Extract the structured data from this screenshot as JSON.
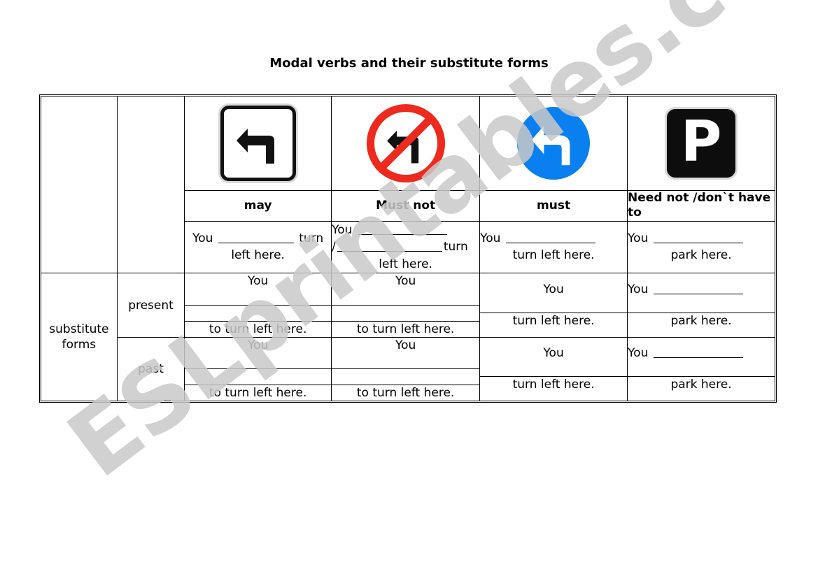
{
  "page": {
    "title": "Modal verbs and their substitute forms",
    "watermark": "ESLprintables.com"
  },
  "table": {
    "row_labels": {
      "substitute_forms": "substitute forms",
      "present": "present",
      "past": "past"
    },
    "columns": [
      {
        "sign": {
          "name": "left-turn-permitted-sign",
          "type": "white-square-arrow",
          "colors": {
            "background": "#ffffff",
            "border": "#111111",
            "arrow": "#111111"
          }
        },
        "modal": "may",
        "sentence": {
          "line1_prefix": "You",
          "line1_suffix": "turn",
          "line2": "left here."
        },
        "present": {
          "word": "You",
          "tail": "to turn left here.",
          "blank_lines": 2
        },
        "past": {
          "word": "You",
          "tail": "to turn left here.",
          "blank_lines": 2
        }
      },
      {
        "sign": {
          "name": "no-left-turn-sign",
          "type": "red-circle-slash-arrow",
          "colors": {
            "ring": "#ee2a1e",
            "background": "#ffffff",
            "arrow": "#111111"
          }
        },
        "modal": "Must not",
        "sentence": {
          "line1_prefix": "You",
          "line2_prefix": "/",
          "line2_suffix": "turn",
          "line3": "left here."
        },
        "present": {
          "word": "You",
          "tail": "to turn left here.",
          "blank_lines": 2
        },
        "past": {
          "word": "You",
          "tail": "to turn left here.",
          "blank_lines": 2
        }
      },
      {
        "sign": {
          "name": "turn-left-mandatory-sign",
          "type": "blue-circle-arrow",
          "colors": {
            "background": "#0a7ff0",
            "arrow": "#ffffff"
          }
        },
        "modal": "must",
        "sentence": {
          "line1_prefix": "You",
          "line2": "turn left here."
        },
        "present": {
          "word": "You",
          "tail": "turn left here.",
          "blank_lines": 1
        },
        "past": {
          "word": "You",
          "tail": "turn left here.",
          "blank_lines": 1
        }
      },
      {
        "sign": {
          "name": "parking-sign",
          "type": "black-square-p",
          "glyph": "P",
          "colors": {
            "background": "#0d0d0d",
            "glyph": "#ffffff"
          }
        },
        "modal": "Need not /don`t have to",
        "sentence": {
          "line1_prefix": "You",
          "line2": "park here."
        },
        "present": {
          "word": "You",
          "tail": "park here.",
          "blank_lines": 1
        },
        "past": {
          "word": "You",
          "tail": "park here.",
          "blank_lines": 1
        }
      }
    ]
  }
}
